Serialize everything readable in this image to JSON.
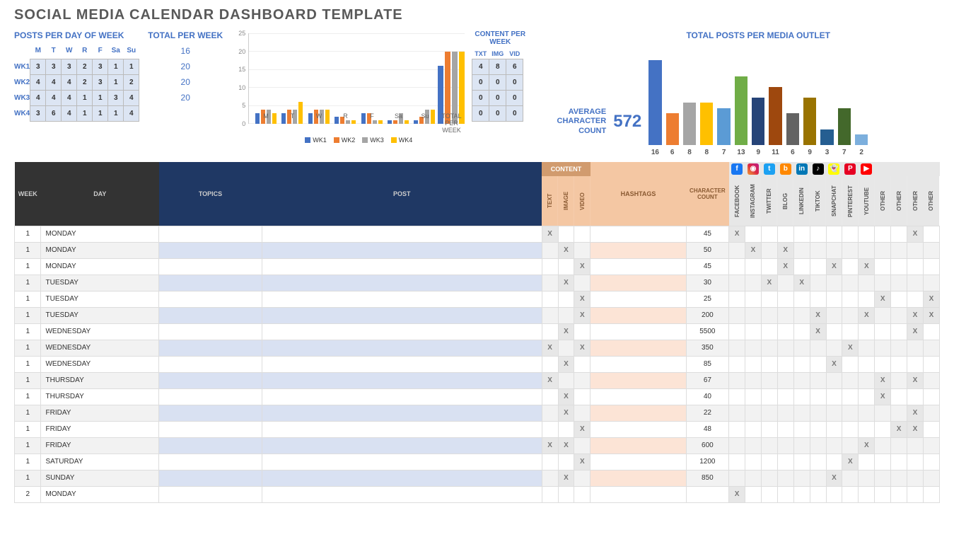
{
  "title": "SOCIAL MEDIA CALENDAR DASHBOARD TEMPLATE",
  "posts_per_day": {
    "title": "POSTS PER DAY OF WEEK",
    "days": [
      "M",
      "T",
      "W",
      "R",
      "F",
      "Sa",
      "Su"
    ],
    "rows": [
      {
        "label": "WK1",
        "vals": [
          "3",
          "3",
          "3",
          "2",
          "3",
          "1",
          "1"
        ]
      },
      {
        "label": "WK2",
        "vals": [
          "4",
          "4",
          "4",
          "2",
          "3",
          "1",
          "2"
        ]
      },
      {
        "label": "WK3",
        "vals": [
          "4",
          "4",
          "4",
          "1",
          "1",
          "3",
          "4"
        ]
      },
      {
        "label": "WK4",
        "vals": [
          "3",
          "6",
          "4",
          "1",
          "1",
          "1",
          "4"
        ]
      }
    ]
  },
  "total_per_week": {
    "title": "TOTAL PER WEEK",
    "vals": [
      "16",
      "20",
      "20",
      "20"
    ]
  },
  "chart_data": {
    "type": "bar",
    "categories": [
      "M",
      "T",
      "W",
      "R",
      "F",
      "Sa",
      "Su",
      "TOTAL PER WEEK"
    ],
    "series": [
      {
        "name": "WK1",
        "values": [
          3,
          3,
          3,
          2,
          3,
          1,
          1,
          16
        ]
      },
      {
        "name": "WK2",
        "values": [
          4,
          4,
          4,
          2,
          3,
          1,
          2,
          20
        ]
      },
      {
        "name": "WK3",
        "values": [
          4,
          4,
          4,
          1,
          1,
          3,
          4,
          20
        ]
      },
      {
        "name": "WK4",
        "values": [
          3,
          6,
          4,
          1,
          1,
          1,
          4,
          20
        ]
      }
    ],
    "ylim": [
      0,
      25
    ],
    "yticks": [
      0,
      5,
      10,
      15,
      20,
      25
    ]
  },
  "content_per_week": {
    "title": "CONTENT PER WEEK",
    "headers": [
      "TXT",
      "IMG",
      "VID"
    ],
    "rows": [
      [
        "4",
        "8",
        "6"
      ],
      [
        "0",
        "0",
        "0"
      ],
      [
        "0",
        "0",
        "0"
      ],
      [
        "0",
        "0",
        "0"
      ]
    ]
  },
  "avg": {
    "label": "AVERAGE CHARACTER COUNT",
    "value": "572"
  },
  "outlets": {
    "title": "TOTAL POSTS PER MEDIA OUTLET",
    "values": [
      16,
      6,
      8,
      8,
      7,
      13,
      9,
      11,
      6,
      9,
      3,
      7,
      2
    ],
    "labels": [
      "16",
      "6",
      "8",
      "8",
      "7",
      "13",
      "9",
      "11",
      "6",
      "9",
      "3",
      "7",
      "2"
    ]
  },
  "headers": {
    "week": "WEEK",
    "day": "DAY",
    "topics": "TOPICS",
    "post": "POST",
    "content": "CONTENT",
    "text": "TEXT",
    "image": "IMAGE",
    "video": "VIDEO",
    "hashtags": "HASHTAGS",
    "charcount": "CHARACTER COUNT",
    "channels": [
      "FACEBOOK",
      "INSTAGRAM",
      "TWITTER",
      "BLOG",
      "LINKEDIN",
      "TIKTOK",
      "SNAPCHAT",
      "PINTEREST",
      "YOUTUBE",
      "OTHER",
      "OTHER",
      "OTHER",
      "OTHER"
    ]
  },
  "rows": [
    {
      "w": "1",
      "day": "MONDAY",
      "t": "X",
      "i": "",
      "v": "",
      "cc": "45",
      "ch": [
        "X",
        "",
        "",
        "",
        "",
        "",
        "",
        "",
        "",
        "",
        "",
        "X",
        ""
      ]
    },
    {
      "w": "1",
      "day": "MONDAY",
      "t": "",
      "i": "X",
      "v": "",
      "cc": "50",
      "ch": [
        "",
        "X",
        "",
        "X",
        "",
        "",
        "",
        "",
        "",
        "",
        "",
        "",
        ""
      ]
    },
    {
      "w": "1",
      "day": "MONDAY",
      "t": "",
      "i": "",
      "v": "X",
      "cc": "45",
      "ch": [
        "",
        "",
        "",
        "X",
        "",
        "",
        "X",
        "",
        "X",
        "",
        "",
        "",
        ""
      ]
    },
    {
      "w": "1",
      "day": "TUESDAY",
      "t": "",
      "i": "X",
      "v": "",
      "cc": "30",
      "ch": [
        "",
        "",
        "X",
        "",
        "X",
        "",
        "",
        "",
        "",
        "",
        "",
        "",
        ""
      ]
    },
    {
      "w": "1",
      "day": "TUESDAY",
      "t": "",
      "i": "",
      "v": "X",
      "cc": "25",
      "ch": [
        "",
        "",
        "",
        "",
        "",
        "",
        "",
        "",
        "",
        "X",
        "",
        "",
        "X"
      ]
    },
    {
      "w": "1",
      "day": "TUESDAY",
      "t": "",
      "i": "",
      "v": "X",
      "cc": "200",
      "ch": [
        "",
        "",
        "",
        "",
        "",
        "X",
        "",
        "",
        "X",
        "",
        "",
        "X",
        "X"
      ]
    },
    {
      "w": "1",
      "day": "WEDNESDAY",
      "t": "",
      "i": "X",
      "v": "",
      "cc": "5500",
      "ch": [
        "",
        "",
        "",
        "",
        "",
        "X",
        "",
        "",
        "",
        "",
        "",
        "X",
        ""
      ]
    },
    {
      "w": "1",
      "day": "WEDNESDAY",
      "t": "X",
      "i": "",
      "v": "X",
      "cc": "350",
      "ch": [
        "",
        "",
        "",
        "",
        "",
        "",
        "",
        "X",
        "",
        "",
        "",
        "",
        ""
      ]
    },
    {
      "w": "1",
      "day": "WEDNESDAY",
      "t": "",
      "i": "X",
      "v": "",
      "cc": "85",
      "ch": [
        "",
        "",
        "",
        "",
        "",
        "",
        "X",
        "",
        "",
        "",
        "",
        "",
        ""
      ]
    },
    {
      "w": "1",
      "day": "THURSDAY",
      "t": "X",
      "i": "",
      "v": "",
      "cc": "67",
      "ch": [
        "",
        "",
        "",
        "",
        "",
        "",
        "",
        "",
        "",
        "X",
        "",
        "X",
        ""
      ]
    },
    {
      "w": "1",
      "day": "THURSDAY",
      "t": "",
      "i": "X",
      "v": "",
      "cc": "40",
      "ch": [
        "",
        "",
        "",
        "",
        "",
        "",
        "",
        "",
        "",
        "X",
        "",
        "",
        ""
      ]
    },
    {
      "w": "1",
      "day": "FRIDAY",
      "t": "",
      "i": "X",
      "v": "",
      "cc": "22",
      "ch": [
        "",
        "",
        "",
        "",
        "",
        "",
        "",
        "",
        "",
        "",
        "",
        "X",
        ""
      ]
    },
    {
      "w": "1",
      "day": "FRIDAY",
      "t": "",
      "i": "",
      "v": "X",
      "cc": "48",
      "ch": [
        "",
        "",
        "",
        "",
        "",
        "",
        "",
        "",
        "",
        "",
        "X",
        "X",
        ""
      ]
    },
    {
      "w": "1",
      "day": "FRIDAY",
      "t": "X",
      "i": "X",
      "v": "",
      "cc": "600",
      "ch": [
        "",
        "",
        "",
        "",
        "",
        "",
        "",
        "",
        "X",
        "",
        "",
        "",
        ""
      ]
    },
    {
      "w": "1",
      "day": "SATURDAY",
      "t": "",
      "i": "",
      "v": "X",
      "cc": "1200",
      "ch": [
        "",
        "",
        "",
        "",
        "",
        "",
        "",
        "X",
        "",
        "",
        "",
        "",
        ""
      ]
    },
    {
      "w": "1",
      "day": "SUNDAY",
      "t": "",
      "i": "X",
      "v": "",
      "cc": "850",
      "ch": [
        "",
        "",
        "",
        "",
        "",
        "",
        "X",
        "",
        "",
        "",
        "",
        "",
        ""
      ]
    },
    {
      "w": "2",
      "day": "MONDAY",
      "t": "",
      "i": "",
      "v": "",
      "cc": "",
      "ch": [
        "X",
        "",
        "",
        "",
        "",
        "",
        "",
        "",
        "",
        "",
        "",
        "",
        ""
      ]
    }
  ]
}
